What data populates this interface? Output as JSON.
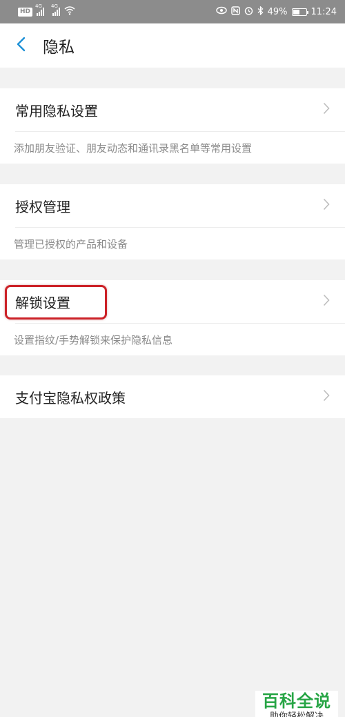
{
  "status_bar": {
    "hd": "HD",
    "net1": "4G",
    "net2": "4G",
    "battery_percent": "49%",
    "battery_level": 0.49,
    "time": "11:24",
    "icons": [
      "wifi-icon",
      "eye-icon",
      "nfc-icon",
      "alarm-icon",
      "bluetooth-icon",
      "battery-icon"
    ]
  },
  "header": {
    "title": "隐私",
    "back_icon": "chevron-left-icon"
  },
  "sections": [
    {
      "label": "常用隐私设置",
      "desc": "添加朋友验证、朋友动态和通讯录黑名单等常用设置"
    },
    {
      "label": "授权管理",
      "desc": "管理已授权的产品和设备"
    },
    {
      "label": "解锁设置",
      "desc": "设置指纹/手势解锁来保护隐私信息"
    },
    {
      "label": "支付宝隐私权政策"
    }
  ],
  "colors": {
    "background": "#f2f2f2",
    "accent": "#1a8fd6",
    "highlight": "#cc2127",
    "watermark": "#27a545"
  },
  "watermark": {
    "title": "百科全说",
    "subtitle": "助你轻松解决"
  }
}
